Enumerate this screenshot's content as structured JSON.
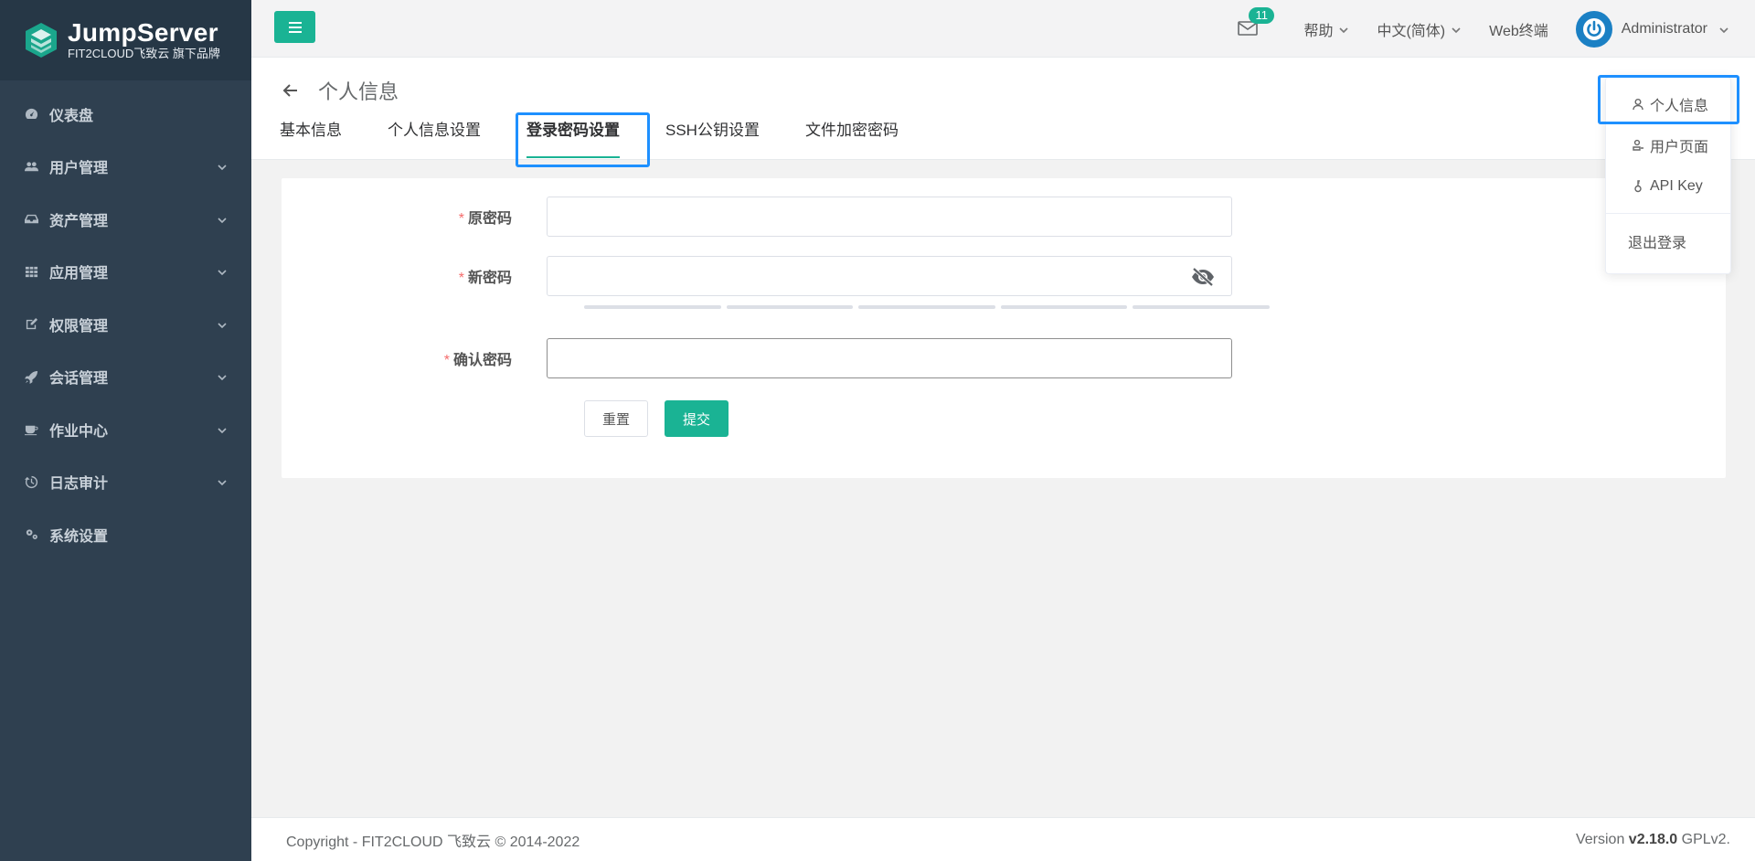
{
  "brand": {
    "title": "JumpServer",
    "subtitle": "FIT2CLOUD飞致云 旗下品牌"
  },
  "sidebar": {
    "items": [
      {
        "label": "仪表盘",
        "icon": "dashboard-icon",
        "has_children": false
      },
      {
        "label": "用户管理",
        "icon": "users-icon",
        "has_children": true
      },
      {
        "label": "资产管理",
        "icon": "inbox-icon",
        "has_children": true
      },
      {
        "label": "应用管理",
        "icon": "grid-icon",
        "has_children": true
      },
      {
        "label": "权限管理",
        "icon": "edit-icon",
        "has_children": true
      },
      {
        "label": "会话管理",
        "icon": "rocket-icon",
        "has_children": true
      },
      {
        "label": "作业中心",
        "icon": "coffee-icon",
        "has_children": true
      },
      {
        "label": "日志审计",
        "icon": "history-icon",
        "has_children": true
      },
      {
        "label": "系统设置",
        "icon": "gears-icon",
        "has_children": false
      }
    ]
  },
  "header": {
    "mail_count": "11",
    "help": "帮助",
    "language": "中文(简体)",
    "web_terminal": "Web终端",
    "user": "Administrator"
  },
  "page": {
    "title": "个人信息",
    "tabs": [
      {
        "label": "基本信息",
        "active": false
      },
      {
        "label": "个人信息设置",
        "active": false
      },
      {
        "label": "登录密码设置",
        "active": true
      },
      {
        "label": "SSH公钥设置",
        "active": false
      },
      {
        "label": "文件加密密码",
        "active": false
      }
    ]
  },
  "form": {
    "old_password_label": "原密码",
    "new_password_label": "新密码",
    "confirm_password_label": "确认密码",
    "old_password_value": "",
    "new_password_value": "",
    "confirm_password_value": "",
    "required_mark": "*",
    "reset_label": "重置",
    "submit_label": "提交"
  },
  "dropdown": {
    "profile": "个人信息",
    "user_page": "用户页面",
    "api_key": "API Key",
    "logout": "退出登录"
  },
  "footer": {
    "copyright": "Copyright - FIT2CLOUD 飞致云 © 2014-2022",
    "version_prefix": "Version ",
    "version": "v2.18.0",
    "version_suffix": " GPLv2."
  },
  "colors": {
    "accent": "#1ab394",
    "sidebar": "#2f4050",
    "highlight": "#1e90ff"
  }
}
